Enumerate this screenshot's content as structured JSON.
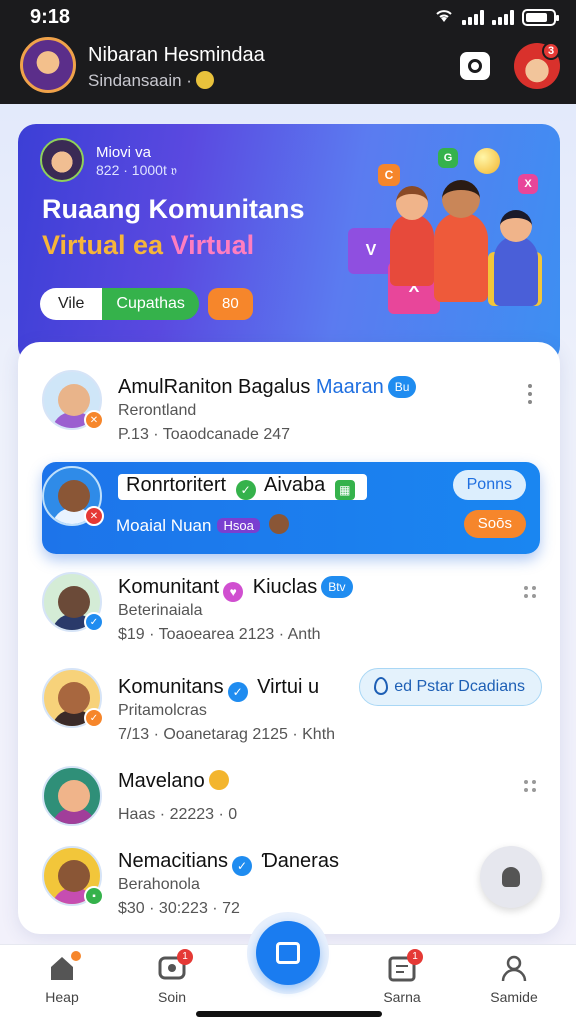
{
  "status_bar": {
    "time": "9:18"
  },
  "header": {
    "user_name": "Nibaran Hesmindaa",
    "user_sub": "Sindansaain ·",
    "notification_count": "3"
  },
  "hero": {
    "user": "Miovi va",
    "meta": "822 · 1000t 𝔳",
    "title": "Ruaang Komunitans",
    "subtitle_a": "Virtual ea ",
    "subtitle_b": "Virtual",
    "pill_left": "Vile",
    "pill_right": "Cupathas",
    "pill_count": "80"
  },
  "communities": [
    {
      "title": "AmulRaniton Bagalus ",
      "title_highlight": "Maaran",
      "tag": "Bu",
      "sub": "Rerontland",
      "meta": "P.13 · Toaodcanade  247",
      "avatar_color": "#9b5fd0",
      "badge_color": "#f6862b"
    },
    {
      "title": "Ronrtoritert",
      "title_b": "Aivaba",
      "sub": "Moaial Nuan",
      "chip": "Hsoa",
      "btn_top": "Ponns",
      "btn_bottom": "Soōs",
      "avatar_color": "#2a3a6a",
      "badge_color": "#e53935"
    },
    {
      "title": "Komunitant",
      "title_b": " Kiuclas",
      "tag": "Btv",
      "sub": "Beterinaiala",
      "meta": "$19 · Toaoearea 2123  ·  Anth",
      "avatar_color": "#2a3a6a",
      "badge_color": "#1f8cf0"
    },
    {
      "title": "Komunitans",
      "title_b": " Virtui u",
      "sub": "Pritamolcras",
      "meta": "7/13 · Ooanetarag 2125  ·  Khth",
      "join_label": "ed Pstar Dcadians",
      "avatar_color": "#f6862b",
      "badge_color": "#f6862b"
    },
    {
      "title": "Mavelano",
      "sub": "",
      "meta": "Haas · 22223 · 0",
      "avatar_color": "#a13e9a",
      "badge_color": "#35b24b"
    },
    {
      "title": "Nemacitians",
      "title_b": " Ɗaneras",
      "sub": "Berahonola",
      "meta": "$30 · 30:223 · 72",
      "avatar_color": "#c64db1",
      "badge_color": "#35b24b"
    }
  ],
  "bottom_nav": {
    "items": [
      {
        "label": "Heap",
        "badge": ""
      },
      {
        "label": "Soin",
        "badge": "1"
      },
      {
        "label": "Sarna",
        "badge": "1"
      },
      {
        "label": "Samide",
        "badge": ""
      }
    ]
  },
  "colors": {
    "accent": "#1a7cf0",
    "orange": "#f6862b",
    "green": "#35b24b",
    "header_bg": "#1b1b1d"
  }
}
